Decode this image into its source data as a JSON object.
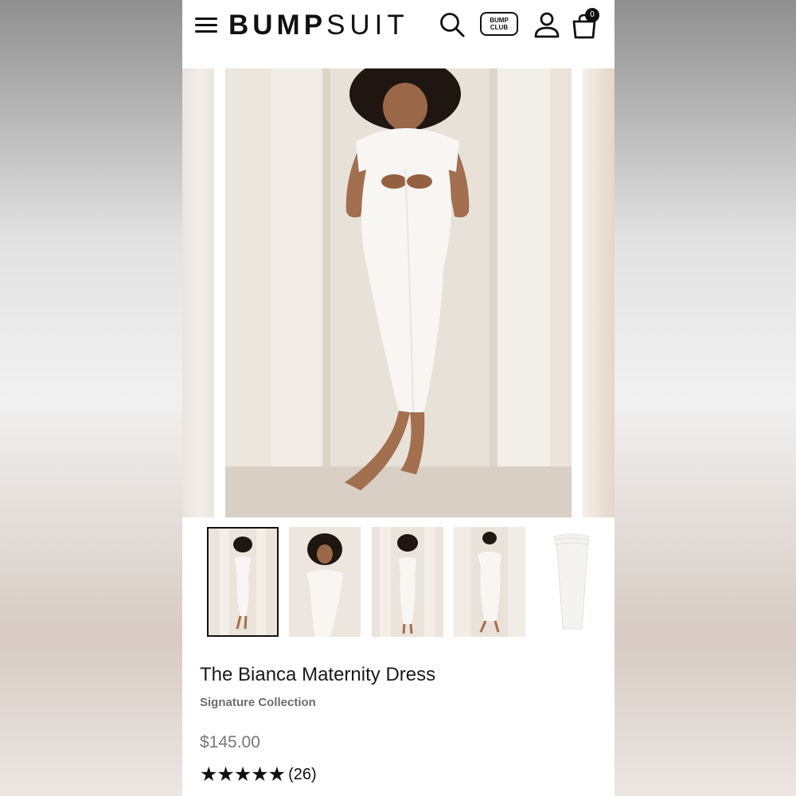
{
  "header": {
    "logo_bold": "BUMP",
    "logo_light": "SUIT",
    "bump_club_line1": "BUMP",
    "bump_club_line2": "CLUB",
    "cart_count": "0",
    "icons": [
      "menu-icon",
      "search-icon",
      "account-icon",
      "cart-icon"
    ]
  },
  "gallery": {
    "thumbnail_count": 5,
    "active_index": 0
  },
  "product": {
    "title": "The Bianca Maternity Dress",
    "collection": "Signature Collection",
    "price": "$145.00",
    "stars": "★★★★★",
    "rating": 5,
    "review_count": "(26)"
  },
  "colors": {
    "text": "#111111",
    "muted": "#777777",
    "background": "#ffffff",
    "dress": "#f7f6f3",
    "skin": "#a26f4f",
    "hair": "#1f1612",
    "wall": "#e9e3dc"
  }
}
